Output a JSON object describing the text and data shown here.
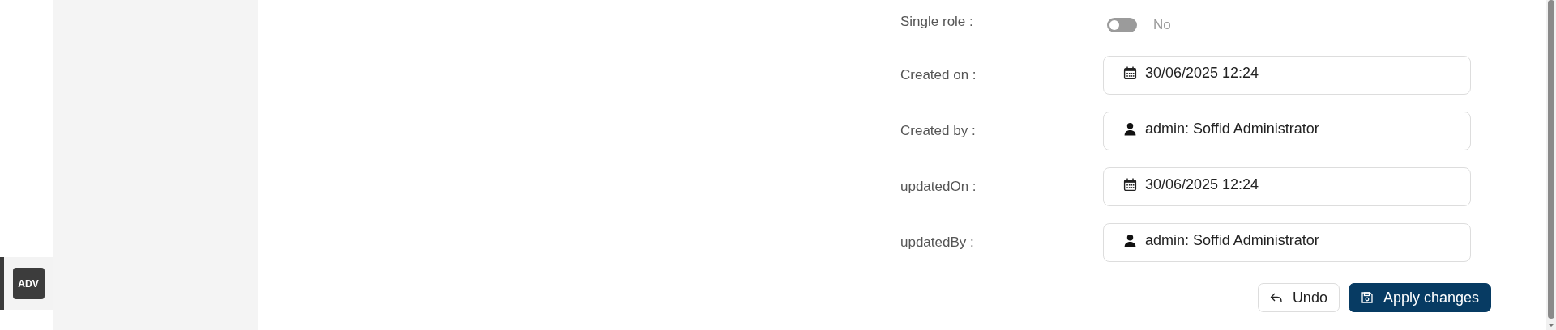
{
  "rail": {
    "items": [
      {
        "label": "ADV",
        "selected": true
      }
    ]
  },
  "form": {
    "toggle_row": {
      "label": "Single role :",
      "on": false,
      "value": "No"
    },
    "fields": [
      {
        "label": "Created on :",
        "kind": "date",
        "value": "30/06/2025 12:24"
      },
      {
        "label": "Created by :",
        "kind": "user",
        "value": "admin: Soffid Administrator"
      },
      {
        "label": "updatedOn :",
        "kind": "date",
        "value": "30/06/2025 12:24"
      },
      {
        "label": "updatedBy :",
        "kind": "user",
        "value": "admin: Soffid Administrator"
      }
    ]
  },
  "buttons": [
    {
      "label": "Undo",
      "kind": "undo"
    },
    {
      "label": "Apply changes",
      "kind": "apply"
    }
  ]
}
